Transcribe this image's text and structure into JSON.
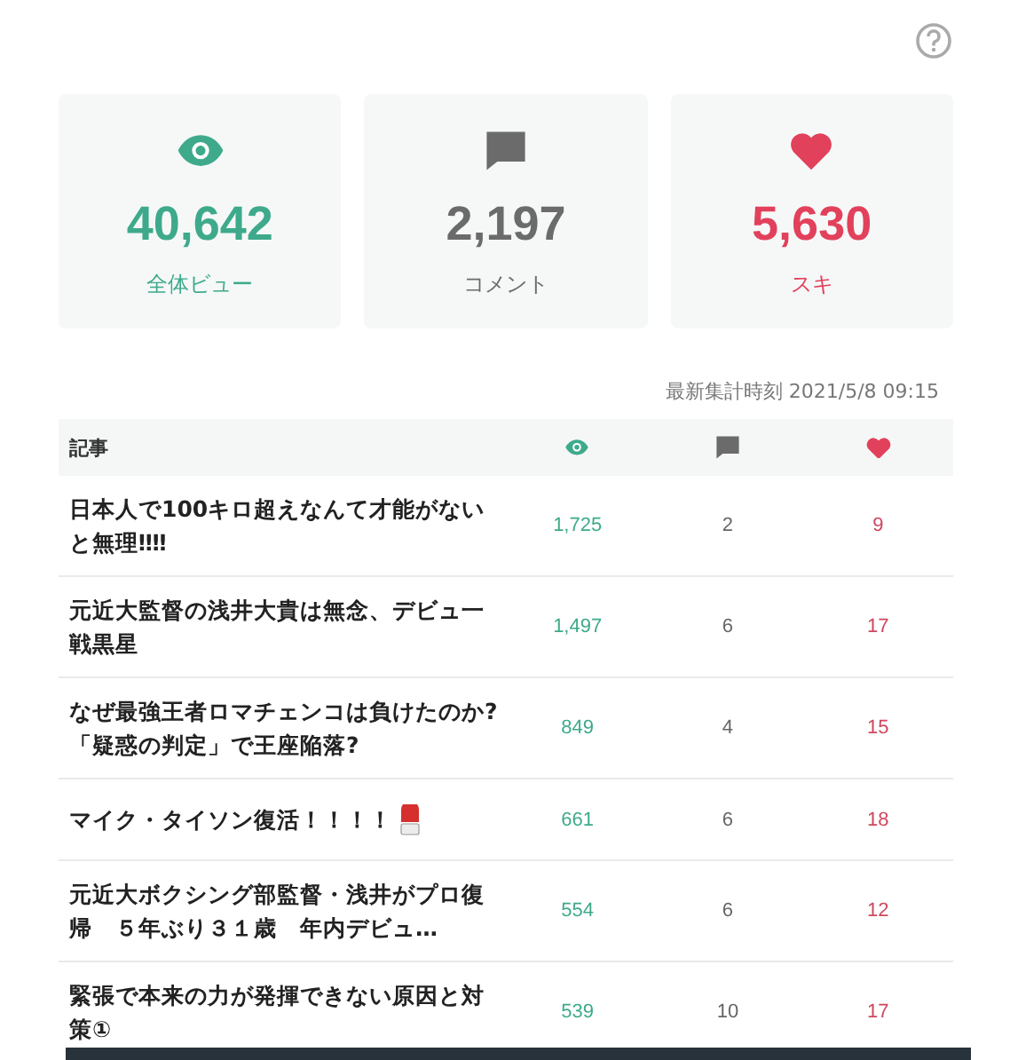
{
  "stats": [
    {
      "kind": "views",
      "value": "40,642",
      "label": "全体ビュー"
    },
    {
      "kind": "comments",
      "value": "2,197",
      "label": "コメント"
    },
    {
      "kind": "likes",
      "value": "5,630",
      "label": "スキ"
    }
  ],
  "updated": "最新集計時刻 2021/5/8 09:15",
  "table": {
    "columns": [
      {
        "kind": "text",
        "label": "記事"
      },
      {
        "kind": "views"
      },
      {
        "kind": "comments"
      },
      {
        "kind": "likes"
      }
    ],
    "rows": [
      {
        "title": "日本人で100キロ超えなんて才能がないと無理‼‼",
        "views": "1,725",
        "comments": "2",
        "likes": "9"
      },
      {
        "title": "元近大監督の浅井大貴は無念、デビュ一戦黒星",
        "views": "1,497",
        "comments": "6",
        "likes": "17"
      },
      {
        "title": "なぜ最強王者ロマチェンコは負けたのか?「疑惑の判定」で王座陥落?",
        "views": "849",
        "comments": "4",
        "likes": "15"
      },
      {
        "title": "マイク・タイソン復活！！！！",
        "glove": true,
        "views": "661",
        "comments": "6",
        "likes": "18"
      },
      {
        "title": "元近大ボクシング部監督・浅井がプロ復帰　５年ぶり３１歳　年内デビュ…",
        "views": "554",
        "comments": "6",
        "likes": "12"
      },
      {
        "title": "緊張で本来の力が発揮できない原因と対策①",
        "views": "539",
        "comments": "10",
        "likes": "17"
      }
    ]
  }
}
